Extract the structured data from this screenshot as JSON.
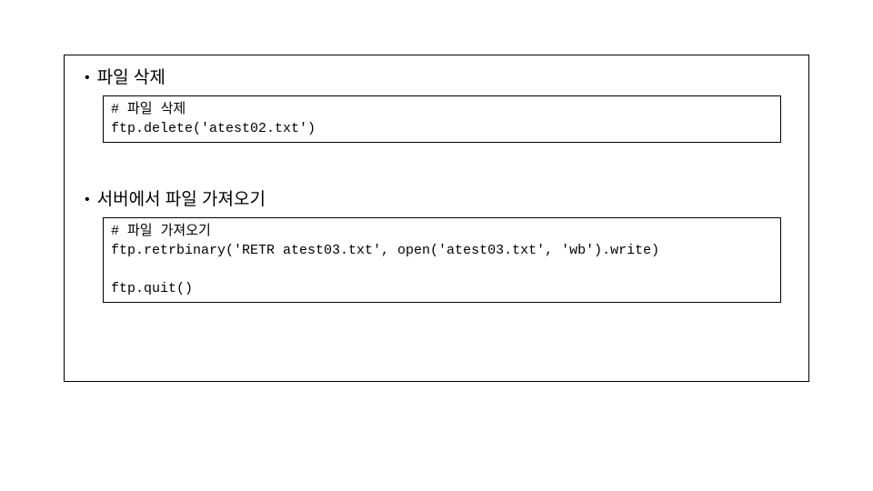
{
  "sections": [
    {
      "title": "파일 삭제",
      "code": "# 파일 삭제\nftp.delete('atest02.txt')"
    },
    {
      "title": "서버에서 파일 가져오기",
      "code": "# 파일 가져오기\nftp.retrbinary('RETR atest03.txt', open('atest03.txt', 'wb').write)\n\nftp.quit()"
    }
  ]
}
